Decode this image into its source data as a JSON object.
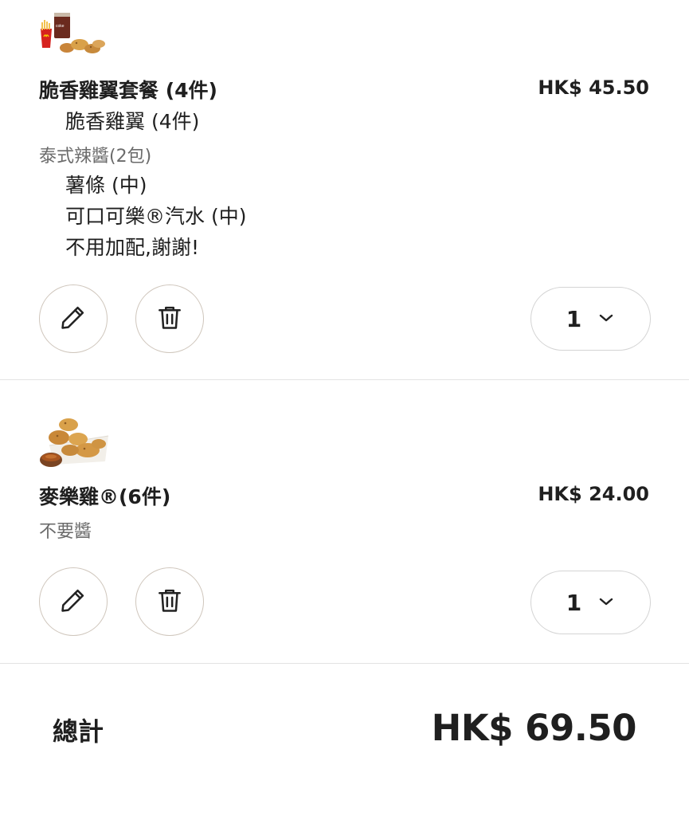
{
  "cart": {
    "items": [
      {
        "name": "脆香雞翼套餐 (4件)",
        "price": "HK$ 45.50",
        "thumbnail": "combo-meal-image",
        "options": [
          {
            "text": "脆香雞翼 (4件)",
            "style": "sub"
          },
          {
            "text": "泰式辣醬(2包)",
            "style": "note"
          },
          {
            "text": "薯條 (中)",
            "style": "sub"
          },
          {
            "text": "可口可樂®汽水 (中)",
            "style": "sub"
          },
          {
            "text": "不用加配,謝謝!",
            "style": "sub"
          }
        ],
        "quantity": "1"
      },
      {
        "name": "麥樂雞®(6件)",
        "price": "HK$ 24.00",
        "thumbnail": "nuggets-image",
        "options": [
          {
            "text": "不要醬",
            "style": "note"
          }
        ],
        "quantity": "1"
      }
    ]
  },
  "total": {
    "label": "總計",
    "value": "HK$ 69.50"
  },
  "icons": {
    "edit": "pencil-icon",
    "delete": "trash-icon",
    "dropdown": "chevron-down-icon"
  },
  "colors": {
    "text": "#1f1f1f",
    "muted": "#6b6b6b",
    "button_border": "#cfc6bc",
    "divider": "#e3e3e3",
    "fries_red": "#d6231f",
    "nugget_gold": "#d9a14a"
  }
}
